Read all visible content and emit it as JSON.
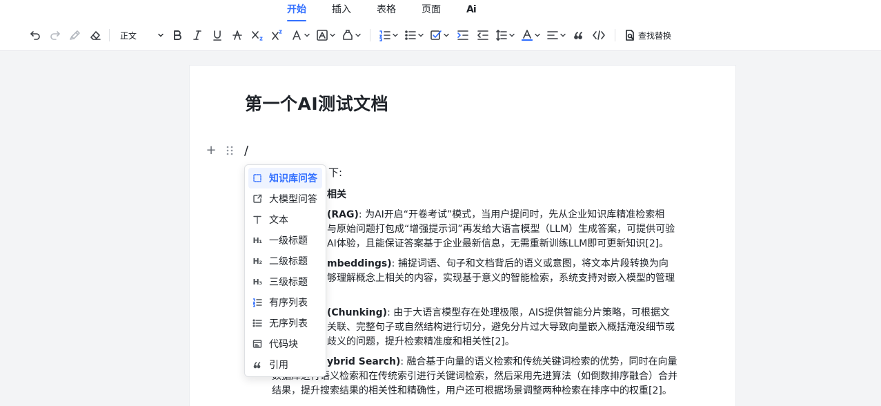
{
  "tabs": [
    {
      "label": "开始",
      "active": true
    },
    {
      "label": "插入"
    },
    {
      "label": "表格"
    },
    {
      "label": "页面"
    },
    {
      "label": "Ai"
    }
  ],
  "toolbar": {
    "paragraph_style": "正文",
    "find_replace": "查找替换",
    "icons": [
      "undo-icon",
      "redo-icon",
      "format-painter-icon",
      "clear-format-icon",
      "bold-icon",
      "italic-icon",
      "underline-icon",
      "strikethrough-icon",
      "subscript-icon",
      "superscript-icon",
      "font-color-icon",
      "background-color-icon",
      "highlight-icon",
      "ordered-list-icon",
      "unordered-list-icon",
      "task-list-icon",
      "indent-icon",
      "outdent-icon",
      "line-height-icon",
      "text-color-icon",
      "align-icon",
      "quote-icon",
      "code-icon"
    ]
  },
  "document": {
    "title": "第一个AI测试文档",
    "caret": "/",
    "lines": [
      {
        "text": "下:"
      },
      {
        "text": "相关",
        "bold": true
      },
      {
        "bold": "(RAG)",
        "text": ": 为AI开启“开卷考试”模式，当用户提问时，先从企业知识库精准检索相"
      },
      {
        "text": "与原始问题打包成“增强提示词”再发给大语言模型（LLM）生成答案，可提供可验"
      },
      {
        "text": "AI体验，且能保证答案基于企业最新信息，无需重新训练LLM即可更新知识[2]。"
      },
      {
        "bold": "mbeddings)",
        "text": ": 捕捉词语、句子和文档背后的语义或意图，将文本片段转换为向"
      },
      {
        "text": "够理解概念上相关的内容，实现基于意义的智能检索，系统支持对嵌入模型的管理"
      },
      {
        "bold": "(Chunking)",
        "text": ": 由于大语言模型存在处理极限，AIS提供智能分片策略，可根据文"
      },
      {
        "text": "关联、完整句子或自然结构进行切分，避免分片过大导致向量嵌入概括淹没细节或"
      },
      {
        "text": "歧义的问题，提升检索精准度和相关性[2]。"
      },
      {
        "bold": "ybrid Search)",
        "text": ": 融合基于向量的语义检索和传统关键词检索的优势，同时在向量"
      },
      {
        "text": "数据库进行语义检索和在传统索引进行关键词检索，然后采用先进算法（如倒数排序融合）合并"
      },
      {
        "text": "结果，提升搜索结果的相关性和精确性，用户还可根据场景调整两种检索在排序中的权重[2]。"
      }
    ]
  },
  "slash_menu": {
    "items": [
      {
        "label": "知识库问答",
        "icon": "knowledge-qa-icon",
        "active": true
      },
      {
        "label": "大模型问答",
        "icon": "llm-qa-icon"
      },
      {
        "label": "文本",
        "icon": "text-icon"
      },
      {
        "label": "一级标题",
        "icon": "h1-icon"
      },
      {
        "label": "二级标题",
        "icon": "h2-icon"
      },
      {
        "label": "三级标题",
        "icon": "h3-icon"
      },
      {
        "label": "有序列表",
        "icon": "ordered-list-icon"
      },
      {
        "label": "无序列表",
        "icon": "unordered-list-icon"
      },
      {
        "label": "代码块",
        "icon": "code-block-icon"
      },
      {
        "label": "引用",
        "icon": "quote-icon"
      }
    ]
  },
  "colors": {
    "accent": "#3370ff",
    "active_bg": "#eef3ff",
    "canvas": "#f3f4f6"
  }
}
